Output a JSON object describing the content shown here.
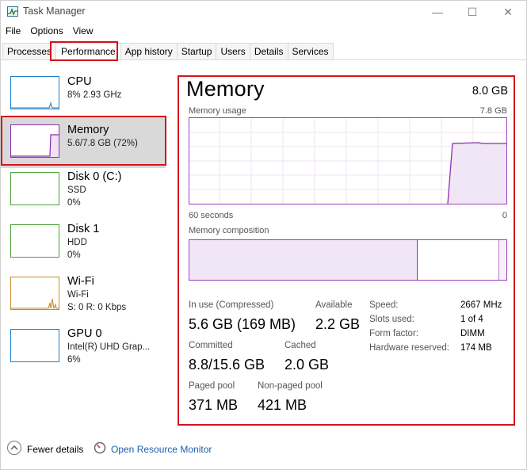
{
  "window": {
    "title": "Task Manager",
    "controls": {
      "minimize": "—",
      "maximize": "☐",
      "close": "✕"
    }
  },
  "menu": [
    "File",
    "Options",
    "View"
  ],
  "tabs": [
    "Processes",
    "Performance",
    "App history",
    "Startup",
    "Users",
    "Details",
    "Services"
  ],
  "active_tab": "Performance",
  "sidebar": {
    "items": [
      {
        "name": "CPU",
        "sub1": "8% 2.93 GHz",
        "sub2": "",
        "sub3": "",
        "color": "#1a7fcf"
      },
      {
        "name": "Memory",
        "sub1": "5.6/7.8 GB (72%)",
        "sub2": "",
        "sub3": "",
        "color": "#8b2fb0"
      },
      {
        "name": "Disk 0 (C:)",
        "sub1": "SSD",
        "sub2": "0%",
        "sub3": "",
        "color": "#4ca33a"
      },
      {
        "name": "Disk 1",
        "sub1": "HDD",
        "sub2": "0%",
        "sub3": "",
        "color": "#4ca33a"
      },
      {
        "name": "Wi-Fi",
        "sub1": "Wi-Fi",
        "sub2": "S: 0 R: 0 Kbps",
        "sub3": "",
        "color": "#c88a2e"
      },
      {
        "name": "GPU 0",
        "sub1": "Intel(R) UHD Grap...",
        "sub2": "6%",
        "sub3": "",
        "color": "#1a7fcf"
      }
    ],
    "selected": "Memory"
  },
  "memory": {
    "title": "Memory",
    "total": "8.0 GB",
    "usage_label": "Memory usage",
    "usage_max": "7.8 GB",
    "time_left": "60 seconds",
    "time_right": "0",
    "composition_label": "Memory composition",
    "usage_fraction": 0.72,
    "stats": {
      "in_use_label": "In use (Compressed)",
      "in_use_value": "5.6 GB (169 MB)",
      "available_label": "Available",
      "available_value": "2.2 GB",
      "committed_label": "Committed",
      "committed_value": "8.8/15.6 GB",
      "cached_label": "Cached",
      "cached_value": "2.0 GB",
      "paged_label": "Paged pool",
      "paged_value": "371 MB",
      "nonpaged_label": "Non-paged pool",
      "nonpaged_value": "421 MB"
    },
    "specs": {
      "speed_label": "Speed:",
      "speed_value": "2667 MHz",
      "slots_label": "Slots used:",
      "slots_value": "1 of 4",
      "form_label": "Form factor:",
      "form_value": "DIMM",
      "hw_label": "Hardware reserved:",
      "hw_value": "174 MB"
    }
  },
  "footer": {
    "fewer_details": "Fewer details",
    "open_monitor": "Open Resource Monitor"
  },
  "colors": {
    "memory_accent": "#8b2fb0",
    "highlight": "#d4141c",
    "link": "#1a5fb4"
  }
}
